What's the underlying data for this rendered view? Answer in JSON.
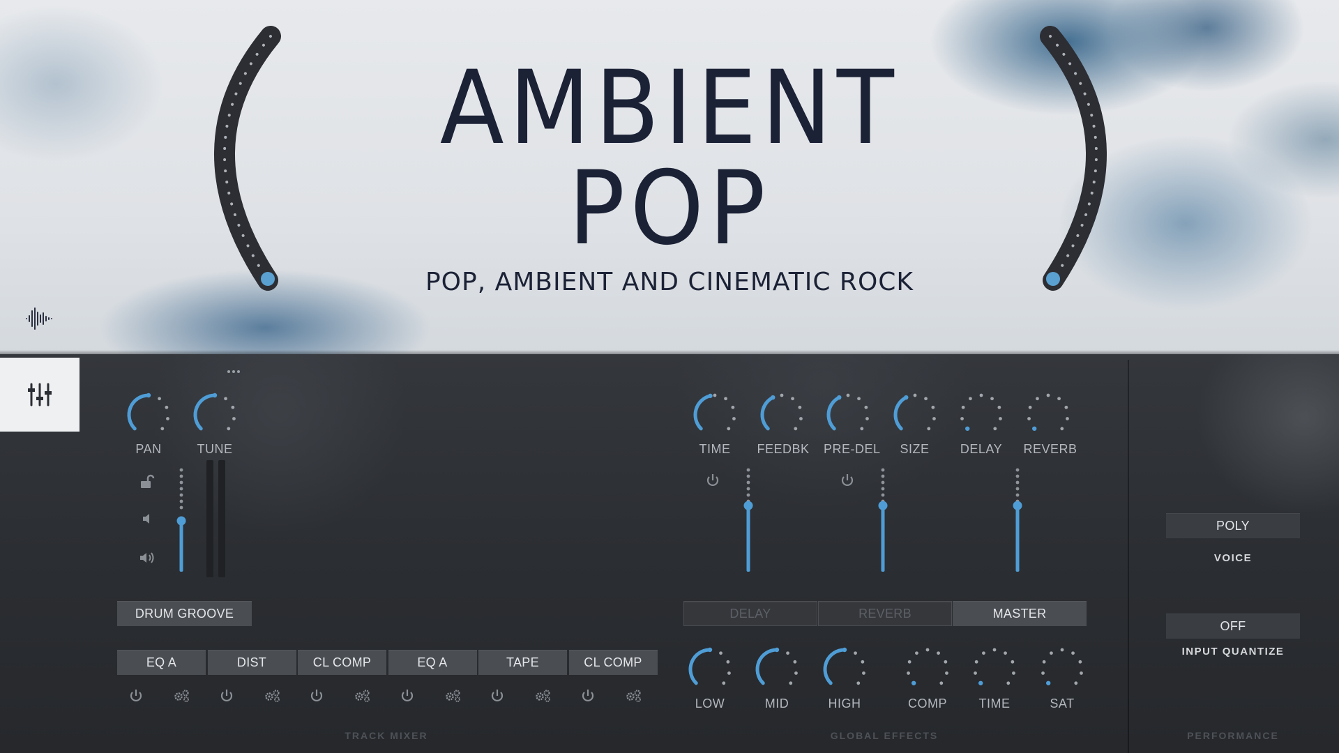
{
  "header": {
    "title_line1": "AMBIENT",
    "title_line2": "POP",
    "subtitle": "POP, AMBIENT AND CINEMATIC ROCK",
    "accent_color": "#4f9dd6"
  },
  "sidebar": {
    "waveform_icon": "waveform-icon",
    "mixer_tab_icon": "sliders-icon"
  },
  "track_mixer": {
    "label": "TRACK MIXER",
    "more_icon": "ellipsis-icon",
    "knobs": [
      {
        "label": "PAN",
        "value": 0.5
      },
      {
        "label": "TUNE",
        "value": 0.5
      }
    ],
    "volume_level": 0.5,
    "icons": [
      "unlock-icon",
      "speaker-low-icon",
      "speaker-high-icon"
    ],
    "preset_button": "DRUM GROOVE",
    "effect_slots": [
      {
        "label": "EQ A"
      },
      {
        "label": "DIST"
      },
      {
        "label": "CL COMP"
      },
      {
        "label": "EQ A"
      },
      {
        "label": "TAPE"
      },
      {
        "label": "CL COMP"
      }
    ]
  },
  "global_effects": {
    "label": "GLOBAL EFFECTS",
    "top_knobs": [
      {
        "label": "TIME",
        "value": 0.45
      },
      {
        "label": "FEEDBK",
        "value": 0.4
      },
      {
        "label": "PRE-DEL",
        "value": 0.4
      },
      {
        "label": "SIZE",
        "value": 0.4
      },
      {
        "label": "DELAY",
        "value": 0.0
      },
      {
        "label": "REVERB",
        "value": 0.0
      }
    ],
    "faders": [
      {
        "name": "delay",
        "level": 0.65
      },
      {
        "name": "reverb",
        "level": 0.65
      },
      {
        "name": "master",
        "level": 0.65
      }
    ],
    "tabs": [
      {
        "label": "DELAY",
        "active": false
      },
      {
        "label": "REVERB",
        "active": false
      },
      {
        "label": "MASTER",
        "active": true
      }
    ],
    "bottom_knobs": [
      {
        "label": "LOW",
        "value": 0.5
      },
      {
        "label": "MID",
        "value": 0.5
      },
      {
        "label": "HIGH",
        "value": 0.5
      },
      {
        "label": "COMP",
        "value": 0.0
      },
      {
        "label": "TIME",
        "value": 0.0
      },
      {
        "label": "SAT",
        "value": 0.0
      }
    ]
  },
  "performance": {
    "label": "PERFORMANCE",
    "voice_button": "POLY",
    "voice_label": "VOICE",
    "quantize_button": "OFF",
    "quantize_label": "INPUT QUANTIZE"
  }
}
